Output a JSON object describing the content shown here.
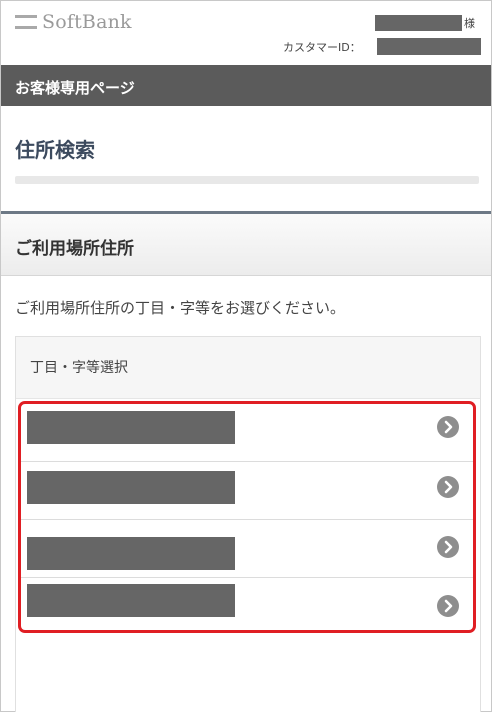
{
  "header": {
    "logo_text": "SoftBank",
    "user_suffix": "様",
    "customer_id_label": "カスタマーID："
  },
  "topbar": {
    "title": "お客様専用ページ"
  },
  "page": {
    "title": "住所検索"
  },
  "section": {
    "title": "ご利用場所住所",
    "instruction": "ご利用場所住所の丁目・字等をお選びください。"
  },
  "selection": {
    "header_label": "丁目・字等選択",
    "options": [
      {
        "icon": "chevron-right-circle-icon"
      },
      {
        "icon": "chevron-right-circle-icon"
      },
      {
        "icon": "chevron-right-circle-icon"
      },
      {
        "icon": "chevron-right-circle-icon"
      }
    ],
    "highlight_color": "#e01e23"
  },
  "colors": {
    "topbar_bg": "#5b5b5b",
    "redaction": "#666666",
    "title_text": "#3c4a5e"
  }
}
